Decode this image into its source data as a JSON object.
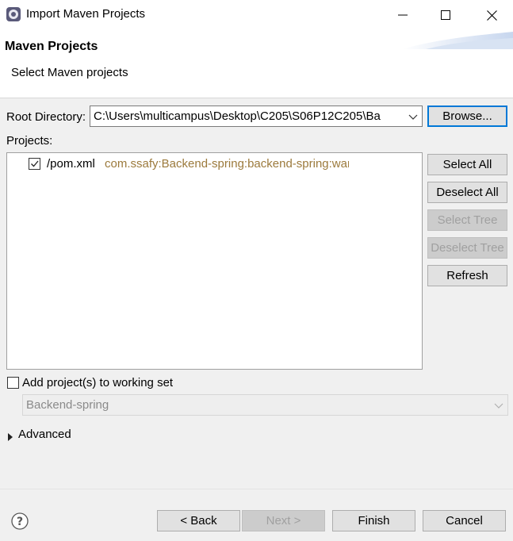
{
  "window": {
    "title": "Import Maven Projects"
  },
  "header": {
    "title": "Maven Projects",
    "description": "Select Maven projects"
  },
  "root_directory": {
    "label": "Root Directory:",
    "value": "C:\\Users\\multicampus\\Desktop\\C205\\S06P12C205\\Ba",
    "browse_label": "Browse..."
  },
  "projects": {
    "label": "Projects:",
    "items": [
      {
        "checked": true,
        "name": "/pom.xml",
        "gav": "com.ssafy:Backend-spring:backend-spring:war"
      }
    ]
  },
  "side_buttons": {
    "select_all": "Select All",
    "deselect_all": "Deselect All",
    "select_tree": "Select Tree",
    "deselect_tree": "Deselect Tree",
    "refresh": "Refresh"
  },
  "working_set": {
    "checked": false,
    "label": "Add project(s) to working set",
    "value": "Backend-spring"
  },
  "advanced": {
    "label": "Advanced"
  },
  "footer": {
    "back": "< Back",
    "next": "Next >",
    "finish": "Finish",
    "cancel": "Cancel"
  },
  "icons": {
    "app": "eclipse-gear-icon",
    "minimize": "minimize-icon",
    "maximize": "maximize-icon",
    "close": "close-icon",
    "help": "help-icon",
    "expand": "triangle-right-icon",
    "dropdown": "chevron-down-icon"
  }
}
